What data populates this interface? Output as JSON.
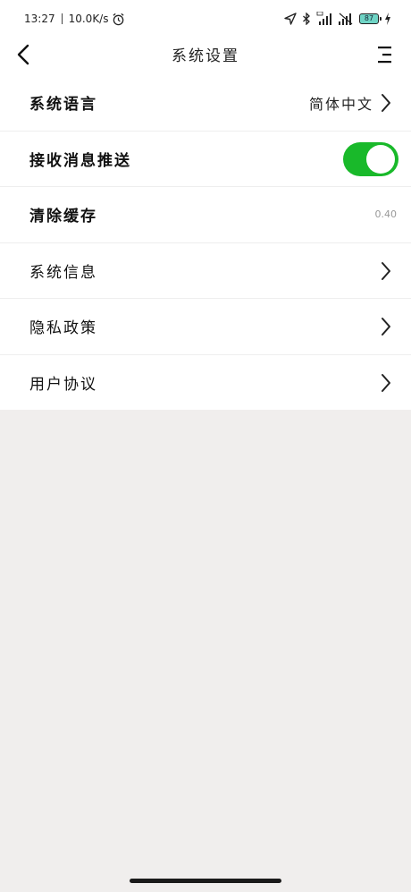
{
  "status_bar": {
    "time": "13:27",
    "net_speed": "10.0K/s",
    "battery": "87"
  },
  "header": {
    "title": "系统设置"
  },
  "settings": {
    "language": {
      "label": "系统语言",
      "value": "简体中文"
    },
    "push": {
      "label": "接收消息推送",
      "enabled": true
    },
    "cache": {
      "label": "清除缓存",
      "value": "0.40"
    },
    "system_info": {
      "label": "系统信息"
    },
    "privacy": {
      "label": "隐私政策"
    },
    "agreement": {
      "label": "用户协议"
    }
  },
  "colors": {
    "accent": "#19b92a",
    "background": "#f0eeed"
  }
}
